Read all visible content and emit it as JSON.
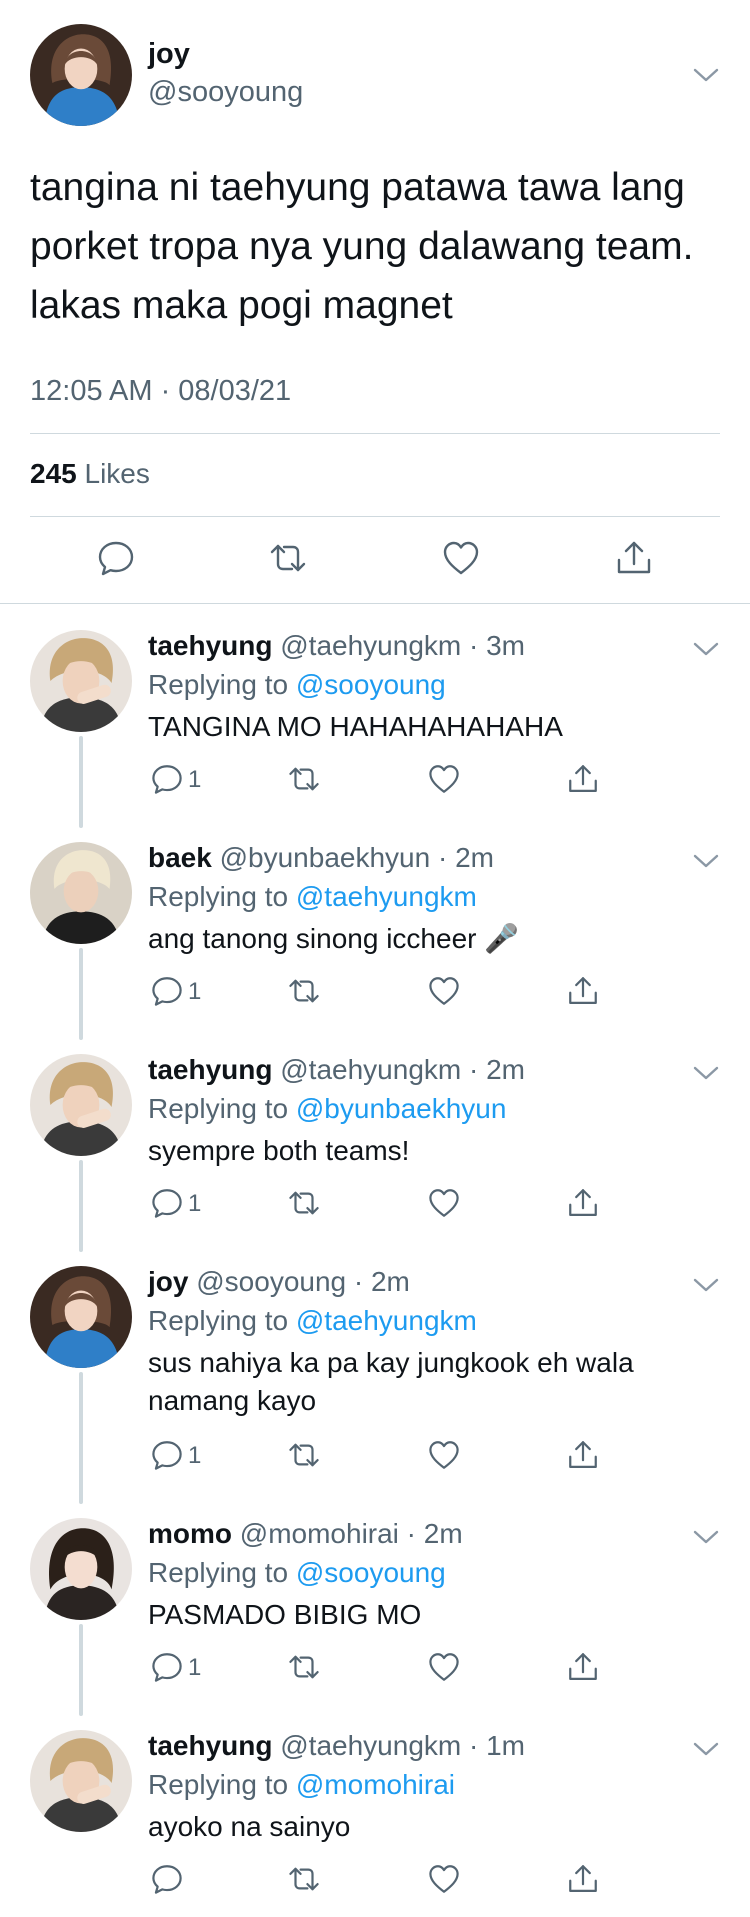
{
  "main_tweet": {
    "name": "joy",
    "handle": "@sooyoung",
    "text_lines": [
      "tangina ni taehyung patawa tawa lang",
      "porket tropa nya yung dalawang team.",
      "lakas maka pogi magnet"
    ],
    "timestamp": "12:05 AM · 08/03/21",
    "likes_count": "245",
    "likes_label": "Likes"
  },
  "replies": [
    {
      "name": "taehyung",
      "meta": " @taehyungkm · 3m",
      "replying_prefix": "Replying to ",
      "replying_to": "@sooyoung",
      "text": "TANGINA MO HAHAHAHAHAHA",
      "reply_count": "1"
    },
    {
      "name": "baek",
      "meta": " @byunbaekhyun · 2m",
      "replying_prefix": "Replying to ",
      "replying_to": "@taehyungkm",
      "text": "ang tanong sinong iccheer 🎤",
      "reply_count": "1"
    },
    {
      "name": "taehyung",
      "meta": " @taehyungkm · 2m",
      "replying_prefix": "Replying to ",
      "replying_to": "@byunbaekhyun",
      "text": "syempre both teams!",
      "reply_count": "1"
    },
    {
      "name": "joy",
      "meta": " @sooyoung · 2m",
      "replying_prefix": "Replying to ",
      "replying_to": "@taehyungkm",
      "text": "sus nahiya ka pa kay jungkook eh wala namang kayo",
      "reply_count": "1"
    },
    {
      "name": "momo",
      "meta": " @momohirai · 2m",
      "replying_prefix": "Replying to ",
      "replying_to": "@sooyoung",
      "text": "PASMADO BIBIG MO",
      "reply_count": "1"
    },
    {
      "name": "taehyung",
      "meta": " @taehyungkm · 1m",
      "replying_prefix": "Replying to ",
      "replying_to": "@momohirai",
      "text": "ayoko na sainyo",
      "reply_count": ""
    }
  ],
  "icons": {
    "reply": "reply-icon",
    "retweet": "retweet-icon",
    "like": "heart-icon",
    "share": "share-icon",
    "more": "chevron-down-icon"
  },
  "colors": {
    "text": "#0f1419",
    "secondary": "#536471",
    "link": "#1d9bf0",
    "divider": "#cfd9de"
  }
}
